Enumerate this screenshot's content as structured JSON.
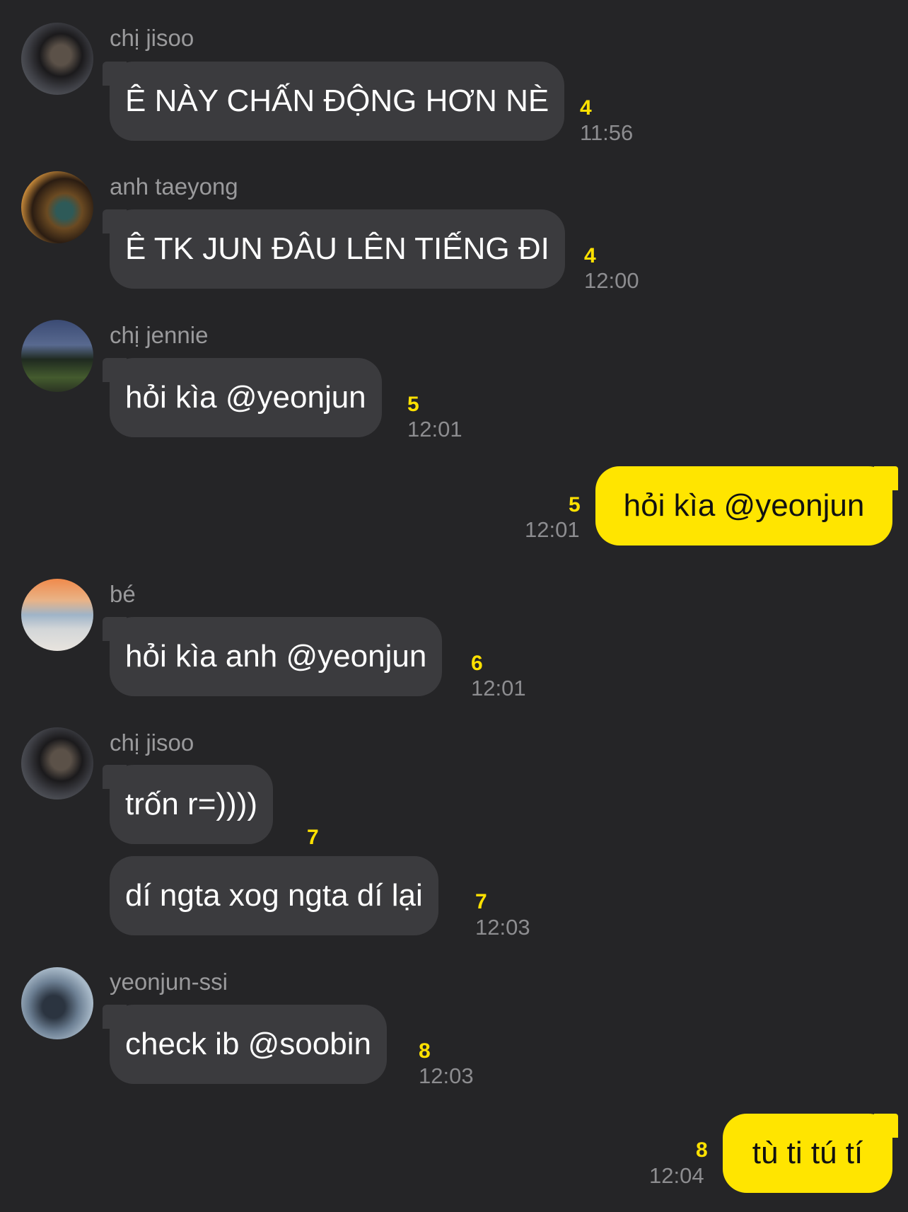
{
  "messages": [
    {
      "sender": "chị jisoo",
      "text": "Ê NÀY CHẤN ĐỘNG HƠN NÈ",
      "count": "4",
      "time": "11:56"
    },
    {
      "sender": "anh taeyong",
      "text": "Ê TK JUN ĐÂU LÊN TIẾNG ĐI",
      "count": "4",
      "time": "12:00"
    },
    {
      "sender": "chị jennie",
      "text": "hỏi kìa @yeonjun",
      "count": "5",
      "time": "12:01"
    },
    {
      "sender": "",
      "text": "hỏi kìa @yeonjun",
      "count": "5",
      "time": "12:01"
    },
    {
      "sender": "bé",
      "text": "hỏi kìa anh @yeonjun",
      "count": "6",
      "time": "12:01"
    },
    {
      "sender": "chị jisoo",
      "text": "trốn r=))))",
      "count": "7",
      "time": ""
    },
    {
      "sender": "",
      "text": "dí ngta xog ngta dí lại",
      "count": "7",
      "time": "12:03"
    },
    {
      "sender": "yeonjun-ssi",
      "text": "check ib @soobin",
      "count": "8",
      "time": "12:03"
    },
    {
      "sender": "",
      "text": "tù ti tú tí",
      "count": "8",
      "time": "12:04"
    }
  ],
  "colors": {
    "background": "#252527",
    "incoming_bubble": "#3b3b3e",
    "outgoing_bubble": "#ffe500",
    "unread_count": "#ffe100"
  }
}
